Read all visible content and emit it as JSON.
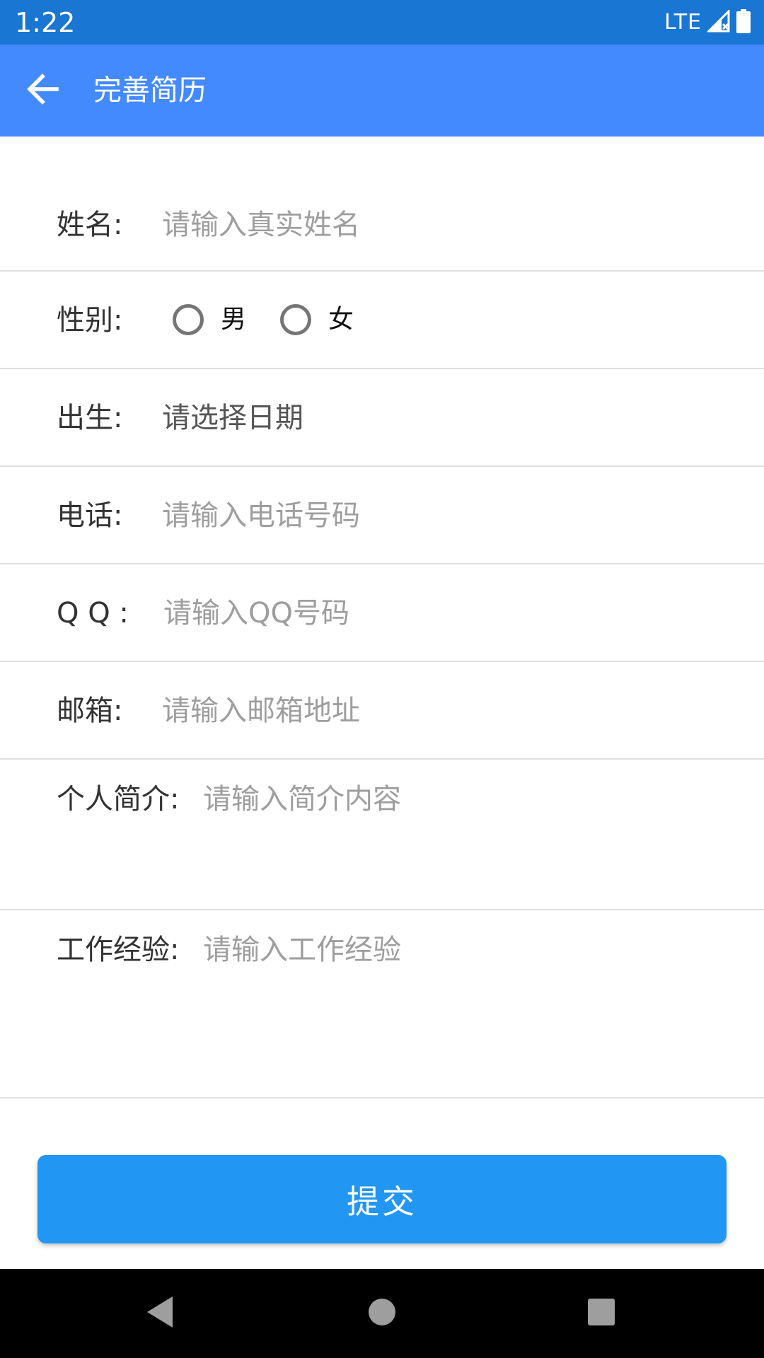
{
  "status_bar": {
    "time": "1:22",
    "network": "LTE"
  },
  "app_bar": {
    "title": "完善简历",
    "back_icon": "arrow-left-icon"
  },
  "form": {
    "name": {
      "label": "姓名:",
      "placeholder": "请输入真实姓名"
    },
    "gender": {
      "label": "性别:",
      "options": [
        {
          "label": "男",
          "selected": false
        },
        {
          "label": "女",
          "selected": false
        }
      ]
    },
    "birth": {
      "label": "出生:",
      "value": "请选择日期"
    },
    "phone": {
      "label": "电话:",
      "placeholder": "请输入电话号码"
    },
    "qq": {
      "label": "Q Q :",
      "placeholder": "请输入QQ号码"
    },
    "email": {
      "label": "邮箱:",
      "placeholder": "请输入邮箱地址"
    },
    "intro": {
      "label": "个人简介:",
      "placeholder": "请输入简介内容"
    },
    "experience": {
      "label": "工作经验:",
      "placeholder": "请输入工作经验"
    }
  },
  "submit": {
    "label": "提交"
  },
  "colors": {
    "status_bar": "#1976d2",
    "app_bar": "#448aff",
    "submit": "#2196f3",
    "divider": "#e0e0e0",
    "placeholder": "#9e9e9e"
  }
}
